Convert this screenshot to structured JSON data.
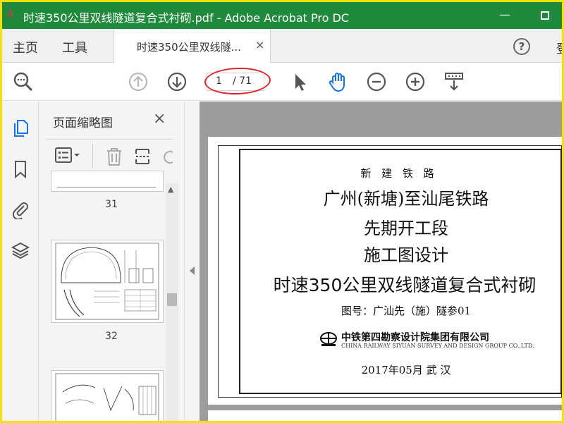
{
  "titlebar": {
    "app_icon_text": "A",
    "title": "时速350公里双线隧道复合式衬砌.pdf - Adobe Acrobat Pro DC",
    "minimize": "—"
  },
  "tabs": {
    "home": "主页",
    "tools": "工具",
    "doc_tab_label": "时速350公里双线隧...",
    "doc_tab_close": "×",
    "help": "?",
    "signin": "登"
  },
  "toolbar": {
    "current_page": "1",
    "total_pages": "/ 71"
  },
  "thumbnail_panel": {
    "title": "页面缩略图",
    "close": "×",
    "page_numbers": [
      "31",
      "32"
    ]
  },
  "document": {
    "subtitle": "新 建 铁 路",
    "line1": "广州(新塘)至汕尾铁路",
    "line2": "先期开工段",
    "line3": "施工图设计",
    "main_title": "时速350公里双线隧道复合式衬砌",
    "drawing_no": "图号：广汕先（施）隧参01",
    "company_cn": "中铁第四勘察设计院集团有限公司",
    "company_en": "CHINA RAILWAY SIYUAN SURVEY AND DESIGN GROUP CO.,LTD.",
    "date_place": "2017年05月    武  汉"
  },
  "colors": {
    "titlebar_bg": "#1f8a3b",
    "annotation_ellipse": "#e0262c",
    "hand_tool_blue": "#1473e6",
    "outer_frame": "#f3e20a"
  }
}
